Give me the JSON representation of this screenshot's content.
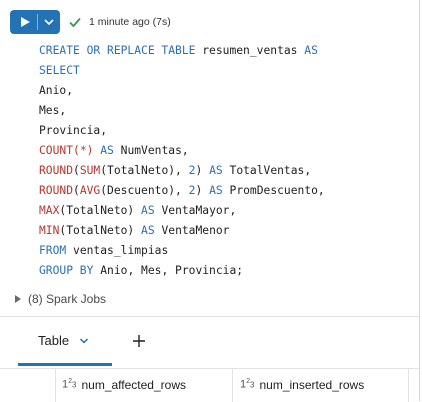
{
  "toolbar": {
    "status_time": "1 minute ago (7s)",
    "run_icon": "play-icon",
    "menu_icon": "chevron-down-icon",
    "status_icon": "check-icon",
    "status_color": "#2e9e4f",
    "accent_color": "#2272b4"
  },
  "code": {
    "l1_kw": "CREATE OR REPLACE TABLE",
    "l1_name": "resumen_ventas",
    "l1_as": "AS",
    "l2": "SELECT",
    "l3": "Anio,",
    "l4": "Mes,",
    "l5": "Provincia,",
    "l6_fn": "COUNT",
    "l6_arg": "(*)",
    "l6_as": "AS",
    "l6_alias": "NumVentas,",
    "l7_round": "ROUND",
    "l7_open": "(",
    "l7_fn": "SUM",
    "l7_arg": "(TotalNeto), ",
    "l7_num": "2",
    "l7_close": ")",
    "l7_as": "AS",
    "l7_alias": "TotalVentas,",
    "l8_round": "ROUND",
    "l8_open": "(",
    "l8_fn": "AVG",
    "l8_arg": "(Descuento), ",
    "l8_num": "2",
    "l8_close": ")",
    "l8_as": "AS",
    "l8_alias": "PromDescuento,",
    "l9_fn": "MAX",
    "l9_arg": "(TotalNeto)",
    "l9_as": "AS",
    "l9_alias": "VentaMayor,",
    "l10_fn": "MIN",
    "l10_arg": "(TotalNeto)",
    "l10_as": "AS",
    "l10_alias": "VentaMenor",
    "l11_kw": "FROM",
    "l11_table": "ventas_limpias",
    "l12_kw": "GROUP BY",
    "l12_cols": "Anio, Mes, Provincia;"
  },
  "spark_jobs": {
    "label": "(8) Spark Jobs"
  },
  "results": {
    "tab_label": "Table",
    "columns": [
      {
        "type_base": "1",
        "type_sup": "2",
        "type_sub": "3",
        "name": "num_affected_rows"
      },
      {
        "type_base": "1",
        "type_sup": "2",
        "type_sub": "3",
        "name": "num_inserted_rows"
      }
    ]
  }
}
